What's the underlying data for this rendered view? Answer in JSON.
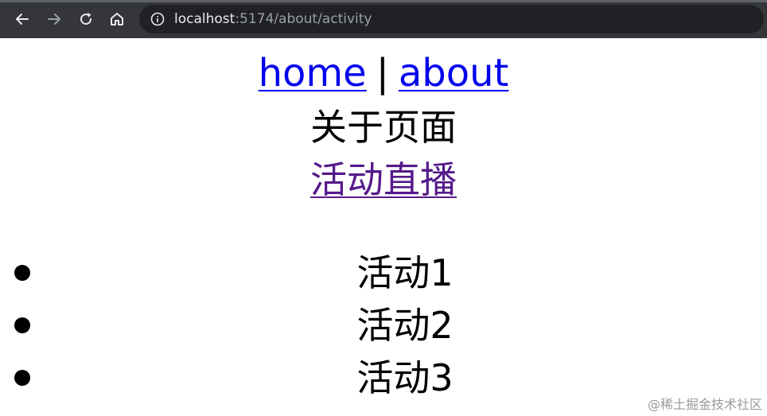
{
  "browser": {
    "url_host": "localhost",
    "url_path": ":5174/about/activity",
    "icons": {
      "back": "arrow-left-icon",
      "forward": "arrow-right-icon",
      "reload": "reload-icon",
      "home": "home-icon",
      "info": "info-icon"
    },
    "colors": {
      "toolbar": "#35363a",
      "address_bar": "#202124"
    }
  },
  "nav": {
    "home_label": "home",
    "separator": "|",
    "about_label": "about"
  },
  "page": {
    "heading": "关于页面",
    "activity_link": "活动直播"
  },
  "activities": [
    "活动1",
    "活动2",
    "活动3"
  ],
  "watermark": "@稀土掘金技术社区",
  "colors": {
    "link": "#0000ee",
    "visited_link": "#551a8b"
  }
}
